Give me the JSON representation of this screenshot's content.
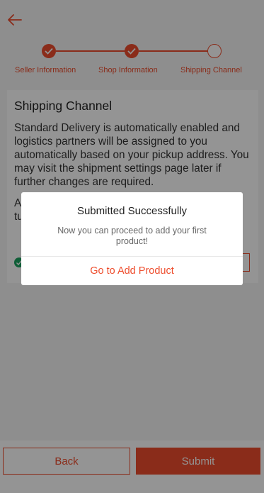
{
  "colors": {
    "accent": "#ee4d2d",
    "success": "#1aa260"
  },
  "header": {
    "back_icon": "arrow-left-icon"
  },
  "stepper": {
    "steps": [
      {
        "label": "Seller Information",
        "state": "done"
      },
      {
        "label": "Shop Information",
        "state": "done"
      },
      {
        "label": "Shipping Channel",
        "state": "current"
      }
    ]
  },
  "card": {
    "title": "Shipping Channel",
    "description": "Standard Delivery is automatically enabled and logistics partners will be assigned to you automatically based on your pickup address. You may visit the shipment settings page later if further changes are required.",
    "line_a": "A",
    "line_b": "tu"
  },
  "footer": {
    "back_label": "Back",
    "submit_label": "Submit"
  },
  "dialog": {
    "title": "Submitted Successfully",
    "message": "Now you can proceed to add your first product!",
    "action_label": "Go to Add Product"
  }
}
